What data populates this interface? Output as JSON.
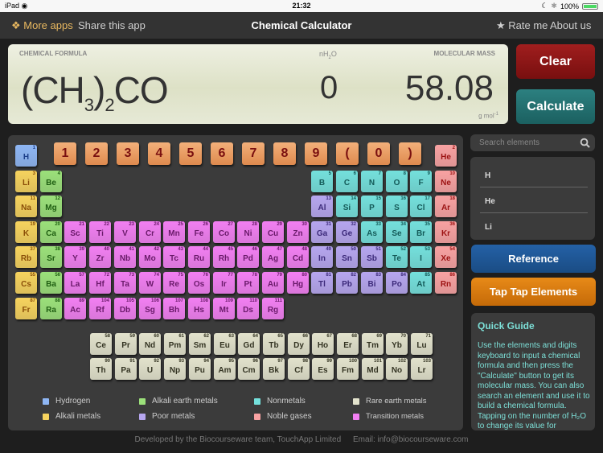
{
  "status": {
    "device": "iPad",
    "time": "21:32",
    "battery": "100%",
    "battery_level": 1.0
  },
  "nav": {
    "more_apps": "More apps",
    "share": "Share this app",
    "title": "Chemical Calculator",
    "rate": "Rate me",
    "about": "About us",
    "star": "★"
  },
  "display": {
    "formula_label": "CHEMICAL FORMULA",
    "nh2o_label_n": "nH",
    "nh2o_label_sub": "2",
    "nh2o_label_o": "O",
    "mass_label": "MOLECULAR MASS",
    "formula_parts": [
      "(CH",
      "3",
      ")",
      "2",
      "CO"
    ],
    "nh2o_value": "0",
    "mass_value": "58.08",
    "unit": "g mol",
    "unit_sup": "-1"
  },
  "buttons": {
    "clear": "Clear",
    "calculate": "Calculate",
    "reference": "Reference",
    "tap_tap": "Tap Tap Elements"
  },
  "keypad": [
    "1",
    "2",
    "3",
    "4",
    "5",
    "6",
    "7",
    "8",
    "9",
    "(",
    "0",
    ")"
  ],
  "category_colors": {
    "hydrogen": {
      "bg": "#8eb6f4",
      "fg": "#1d3f8a"
    },
    "alkali": {
      "bg": "#f6d35e",
      "fg": "#8a4e08"
    },
    "alkaline": {
      "bg": "#9be07a",
      "fg": "#1f5e12"
    },
    "transition": {
      "bg": "#f27ff2",
      "fg": "#6a1a6a"
    },
    "poor": {
      "bg": "#b6a6ef",
      "fg": "#3c2a7a"
    },
    "nonmetal": {
      "bg": "#74e0dc",
      "fg": "#145a58"
    },
    "noble": {
      "bg": "#f8a2a2",
      "fg": "#9c1212"
    },
    "rare": {
      "bg": "#e2e2cc",
      "fg": "#333322"
    }
  },
  "elements": [
    [
      "H",
      1,
      1,
      1,
      "hydrogen"
    ],
    [
      "He",
      2,
      18,
      1,
      "noble"
    ],
    [
      "Li",
      3,
      1,
      2,
      "alkali"
    ],
    [
      "Be",
      4,
      2,
      2,
      "alkaline"
    ],
    [
      "B",
      5,
      13,
      2,
      "nonmetal"
    ],
    [
      "C",
      6,
      14,
      2,
      "nonmetal"
    ],
    [
      "N",
      7,
      15,
      2,
      "nonmetal"
    ],
    [
      "O",
      8,
      16,
      2,
      "nonmetal"
    ],
    [
      "F",
      9,
      17,
      2,
      "nonmetal"
    ],
    [
      "Ne",
      10,
      18,
      2,
      "noble"
    ],
    [
      "Na",
      11,
      1,
      3,
      "alkali"
    ],
    [
      "Mg",
      12,
      2,
      3,
      "alkaline"
    ],
    [
      "Al",
      13,
      13,
      3,
      "poor"
    ],
    [
      "Si",
      14,
      14,
      3,
      "nonmetal"
    ],
    [
      "P",
      15,
      15,
      3,
      "nonmetal"
    ],
    [
      "S",
      16,
      16,
      3,
      "nonmetal"
    ],
    [
      "Cl",
      17,
      17,
      3,
      "nonmetal"
    ],
    [
      "Ar",
      18,
      18,
      3,
      "noble"
    ],
    [
      "K",
      19,
      1,
      4,
      "alkali"
    ],
    [
      "Ca",
      20,
      2,
      4,
      "alkaline"
    ],
    [
      "Sc",
      21,
      3,
      4,
      "transition"
    ],
    [
      "Ti",
      22,
      4,
      4,
      "transition"
    ],
    [
      "V",
      23,
      5,
      4,
      "transition"
    ],
    [
      "Cr",
      24,
      6,
      4,
      "transition"
    ],
    [
      "Mn",
      25,
      7,
      4,
      "transition"
    ],
    [
      "Fe",
      26,
      8,
      4,
      "transition"
    ],
    [
      "Co",
      27,
      9,
      4,
      "transition"
    ],
    [
      "Ni",
      28,
      10,
      4,
      "transition"
    ],
    [
      "Cu",
      29,
      11,
      4,
      "transition"
    ],
    [
      "Zn",
      30,
      12,
      4,
      "transition"
    ],
    [
      "Ga",
      31,
      13,
      4,
      "poor"
    ],
    [
      "Ge",
      32,
      14,
      4,
      "poor"
    ],
    [
      "As",
      33,
      15,
      4,
      "nonmetal"
    ],
    [
      "Se",
      34,
      16,
      4,
      "nonmetal"
    ],
    [
      "Br",
      35,
      17,
      4,
      "nonmetal"
    ],
    [
      "Kr",
      36,
      18,
      4,
      "noble"
    ],
    [
      "Rb",
      37,
      1,
      5,
      "alkali"
    ],
    [
      "Sr",
      38,
      2,
      5,
      "alkaline"
    ],
    [
      "Y",
      39,
      3,
      5,
      "transition"
    ],
    [
      "Zr",
      40,
      4,
      5,
      "transition"
    ],
    [
      "Nb",
      41,
      5,
      5,
      "transition"
    ],
    [
      "Mo",
      42,
      6,
      5,
      "transition"
    ],
    [
      "Tc",
      43,
      7,
      5,
      "transition"
    ],
    [
      "Ru",
      44,
      8,
      5,
      "transition"
    ],
    [
      "Rh",
      45,
      9,
      5,
      "transition"
    ],
    [
      "Pd",
      46,
      10,
      5,
      "transition"
    ],
    [
      "Ag",
      47,
      11,
      5,
      "transition"
    ],
    [
      "Cd",
      48,
      12,
      5,
      "transition"
    ],
    [
      "In",
      49,
      13,
      5,
      "poor"
    ],
    [
      "Sn",
      50,
      14,
      5,
      "poor"
    ],
    [
      "Sb",
      51,
      15,
      5,
      "poor"
    ],
    [
      "Te",
      52,
      16,
      5,
      "nonmetal"
    ],
    [
      "I",
      53,
      17,
      5,
      "nonmetal"
    ],
    [
      "Xe",
      54,
      18,
      5,
      "noble"
    ],
    [
      "Cs",
      55,
      1,
      6,
      "alkali"
    ],
    [
      "Ba",
      56,
      2,
      6,
      "alkaline"
    ],
    [
      "La",
      57,
      3,
      6,
      "transition"
    ],
    [
      "Hf",
      72,
      4,
      6,
      "transition"
    ],
    [
      "Ta",
      73,
      5,
      6,
      "transition"
    ],
    [
      "W",
      74,
      6,
      6,
      "transition"
    ],
    [
      "Re",
      75,
      7,
      6,
      "transition"
    ],
    [
      "Os",
      76,
      8,
      6,
      "transition"
    ],
    [
      "Ir",
      77,
      9,
      6,
      "transition"
    ],
    [
      "Pt",
      78,
      10,
      6,
      "transition"
    ],
    [
      "Au",
      79,
      11,
      6,
      "transition"
    ],
    [
      "Hg",
      80,
      12,
      6,
      "transition"
    ],
    [
      "Tl",
      81,
      13,
      6,
      "poor"
    ],
    [
      "Pb",
      82,
      14,
      6,
      "poor"
    ],
    [
      "Bi",
      83,
      15,
      6,
      "poor"
    ],
    [
      "Po",
      84,
      16,
      6,
      "poor"
    ],
    [
      "At",
      85,
      17,
      6,
      "nonmetal"
    ],
    [
      "Rn",
      86,
      18,
      6,
      "noble"
    ],
    [
      "Fr",
      87,
      1,
      7,
      "alkali"
    ],
    [
      "Ra",
      88,
      2,
      7,
      "alkaline"
    ],
    [
      "Ac",
      89,
      3,
      7,
      "transition"
    ],
    [
      "Rf",
      104,
      4,
      7,
      "transition"
    ],
    [
      "Db",
      105,
      5,
      7,
      "transition"
    ],
    [
      "Sg",
      106,
      6,
      7,
      "transition"
    ],
    [
      "Bh",
      107,
      7,
      7,
      "transition"
    ],
    [
      "Hs",
      108,
      8,
      7,
      "transition"
    ],
    [
      "Mt",
      109,
      9,
      7,
      "transition"
    ],
    [
      "Ds",
      110,
      10,
      7,
      "transition"
    ],
    [
      "Rg",
      111,
      11,
      7,
      "transition"
    ]
  ],
  "lanthanides": [
    [
      "Ce",
      58
    ],
    [
      "Pr",
      59
    ],
    [
      "Nd",
      60
    ],
    [
      "Pm",
      61
    ],
    [
      "Sm",
      62
    ],
    [
      "Eu",
      63
    ],
    [
      "Gd",
      64
    ],
    [
      "Tb",
      65
    ],
    [
      "Dy",
      66
    ],
    [
      "Ho",
      67
    ],
    [
      "Er",
      68
    ],
    [
      "Tm",
      69
    ],
    [
      "Yb",
      70
    ],
    [
      "Lu",
      71
    ]
  ],
  "actinides": [
    [
      "Th",
      90
    ],
    [
      "Pa",
      91
    ],
    [
      "U",
      92
    ],
    [
      "Np",
      93
    ],
    [
      "Pu",
      94
    ],
    [
      "Am",
      95
    ],
    [
      "Cm",
      96
    ],
    [
      "Bk",
      97
    ],
    [
      "Cf",
      98
    ],
    [
      "Es",
      99
    ],
    [
      "Fm",
      100
    ],
    [
      "Md",
      101
    ],
    [
      "No",
      102
    ],
    [
      "Lr",
      103
    ]
  ],
  "legend": [
    {
      "label": "Hydrogen",
      "cat": "hydrogen"
    },
    {
      "label": "Alkali metals",
      "cat": "alkali"
    },
    {
      "label": "Alkali earth metals",
      "cat": "alkaline"
    },
    {
      "label": "Poor metals",
      "cat": "poor"
    },
    {
      "label": "Nonmetals",
      "cat": "nonmetal"
    },
    {
      "label": "Noble gases",
      "cat": "noble"
    },
    {
      "label": "Rare earth metals",
      "cat": "rare"
    },
    {
      "label": "Transition metals",
      "cat": "transition"
    }
  ],
  "search": {
    "placeholder": "Search elements",
    "value": ""
  },
  "search_results": [
    "H",
    "He",
    "Li"
  ],
  "guide": {
    "title": "Quick Guide",
    "text": "Use the elements and digits keyboard to input a chemical formula and then press the \"Calculate\" button to get its molecular mass. You can also search an element and use it to build a chemical formula. Tapping on the number of H₂O to change its value for"
  },
  "footer": {
    "credit": "Developed by the Biocourseware team, TouchApp Limited",
    "email": "Email: info@biocourseware.com"
  }
}
